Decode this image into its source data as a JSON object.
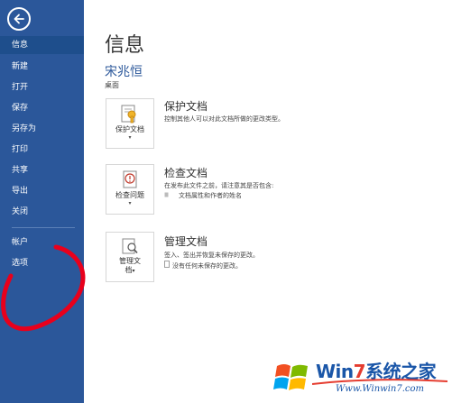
{
  "sidebar": {
    "back_icon": "back-arrow-icon",
    "items": [
      {
        "label": "信息",
        "active": true
      },
      {
        "label": "新建"
      },
      {
        "label": "打开"
      },
      {
        "label": "保存"
      },
      {
        "label": "另存为"
      },
      {
        "label": "打印"
      },
      {
        "label": "共享"
      },
      {
        "label": "导出"
      },
      {
        "label": "关闭"
      },
      {
        "label": "帐户"
      },
      {
        "label": "选项"
      }
    ]
  },
  "main": {
    "title": "信息",
    "doc_name": "宋兆恒",
    "doc_path": "桌面",
    "sections": [
      {
        "tile_label": "保护文档",
        "tile_icon": "lock-key-icon",
        "title": "保护文档",
        "desc": "控制其他人可以对此文档所做的更改类型。"
      },
      {
        "tile_label": "检查问题",
        "tile_icon": "inspect-document-icon",
        "title": "检查文档",
        "desc": "在发布此文件之前，请注意其是否包含:",
        "bullets": [
          "文档属性和作者的姓名"
        ]
      },
      {
        "tile_label_line1": "管理文",
        "tile_label_line2": "档",
        "tile_icon": "manage-document-icon",
        "title": "管理文档",
        "desc": "签入、签出并恢复未保存的更改。",
        "bullets": [
          "没有任何未保存的更改。"
        ]
      }
    ]
  },
  "watermark": {
    "brand_prefix": "Win",
    "brand_seven": "7",
    "brand_suffix": "系统之家",
    "url": "Www.Winwin7.com"
  },
  "colors": {
    "sidebar": "#2b579a",
    "accent": "#2b579a",
    "annotation": "#e8001c"
  }
}
